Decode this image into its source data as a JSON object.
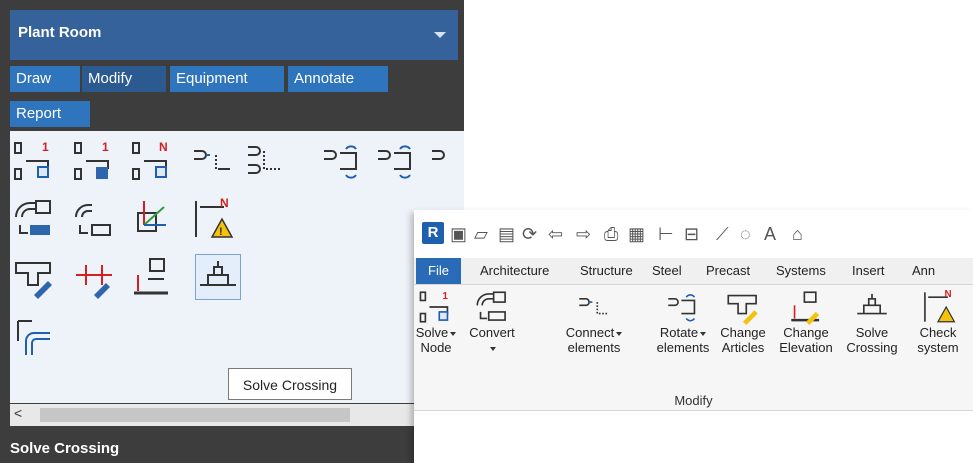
{
  "palette": {
    "title": "Plant Room",
    "tabs": [
      "Draw",
      "Modify",
      "Equipment",
      "Annotate",
      "Report"
    ],
    "tooltip": "Solve Crossing",
    "status": "Solve Crossing",
    "scroll_left": "<",
    "icons": [
      "solve-node-icon",
      "solve-node-select-icon",
      "solve-node-n-icon",
      "connect-elements-icon",
      "connect-elements-2-icon",
      "rotate-elements-icon",
      "rotate-elements-2-icon",
      "rotate-elements-3-icon",
      "convert-icon",
      "convert-2-icon",
      "change-axis-icon",
      "check-system-icon",
      "change-articles-icon",
      "measure-icon",
      "change-elevation-icon",
      "solve-crossing-icon",
      "branch-connect-icon"
    ]
  },
  "ribbon": {
    "logo": "R",
    "tabs": [
      "File",
      "Architecture",
      "Structure",
      "Steel",
      "Precast",
      "Systems",
      "Insert",
      "Ann"
    ],
    "buttons": [
      {
        "line1": "Solve",
        "line2": "Node",
        "dropdown": true
      },
      {
        "line1": "Convert",
        "line2": "",
        "dropdown": true
      },
      {
        "line1": "Connect",
        "line2": "elements",
        "dropdown": true
      },
      {
        "line1": "Rotate",
        "line2": "elements",
        "dropdown": true
      },
      {
        "line1": "Change",
        "line2": "Articles",
        "dropdown": false
      },
      {
        "line1": "Change",
        "line2": "Elevation",
        "dropdown": false
      },
      {
        "line1": "Solve",
        "line2": "Crossing",
        "dropdown": false
      },
      {
        "line1": "Check",
        "line2": "system",
        "dropdown": false
      }
    ],
    "panel_name": "Modify",
    "qat_letter": "A"
  },
  "colors": {
    "palette_bg": "#3d3d3d",
    "palette_title_bg": "#35629a",
    "palette_tab_bg": "#2f75bd",
    "ribbon_file_tab": "#2a6bb8",
    "accent_red": "#d62020",
    "accent_blue": "#1f5fb0",
    "warning_yellow": "#f4c20d"
  }
}
